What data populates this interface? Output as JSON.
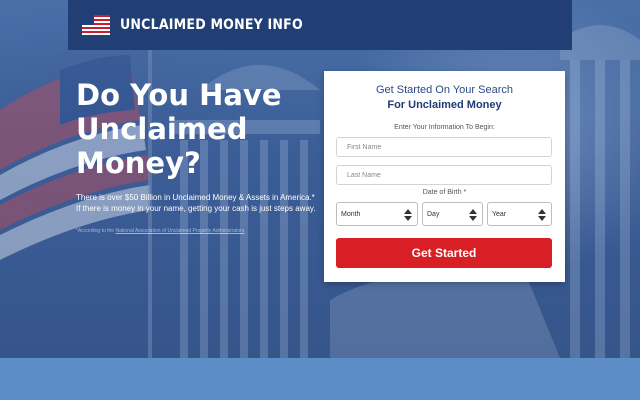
{
  "header": {
    "brand": "UNCLAIMED MONEY INFO",
    "flag_icon": "us-flag-icon"
  },
  "hero": {
    "headline": "Do You Have\nUnclaimed\nMoney?",
    "subtext": "There is over $50 Billion in Unclaimed Money & Assets in America.* If there is money in your name, getting your cash is just steps away.",
    "footnote_prefix": "*According to the",
    "footnote_link": "National Association of Unclaimed Property Administrators"
  },
  "form": {
    "title_line1": "Get Started On Your Search",
    "title_line2": "For Unclaimed Money",
    "instruction": "Enter Your Information To Begin:",
    "first_name_placeholder": "First Name",
    "last_name_placeholder": "Last Name",
    "dob_label": "Date of Birth *",
    "month_label": "Month",
    "day_label": "Day",
    "year_label": "Year",
    "submit_label": "Get Started"
  },
  "colors": {
    "header_bg": "#213f75",
    "cta": "#d81f26",
    "title": "#1e3c74"
  }
}
